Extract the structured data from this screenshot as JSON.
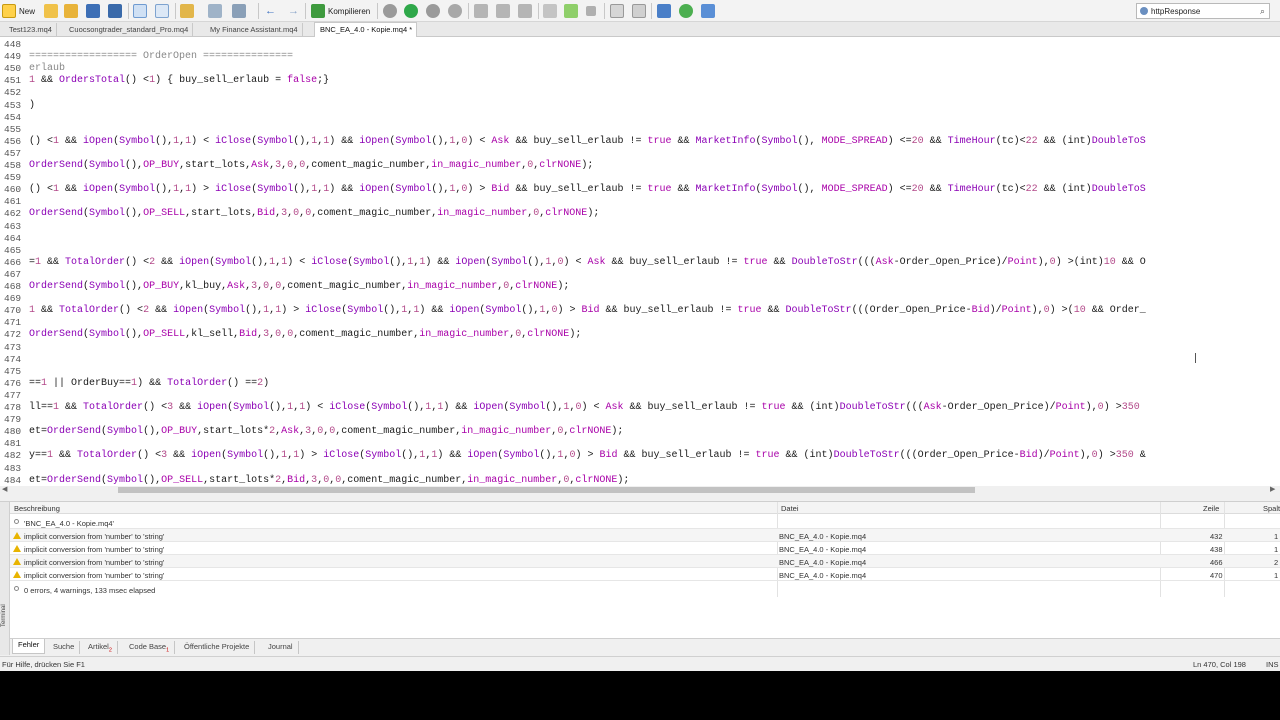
{
  "toolbar": {
    "new_label": "New",
    "compile_label": "Kompilieren",
    "search_value": "httpResponse"
  },
  "tabs": [
    {
      "label": "Test123.mq4"
    },
    {
      "label": "Cuocsongtrader_standard_Pro.mq4"
    },
    {
      "label": "My Finance Assistant.mq4"
    },
    {
      "label": "BNC_EA_4.0 - Kopie.mq4 *"
    }
  ],
  "editor": {
    "lines": [
      {
        "n": "448",
        "t": ""
      },
      {
        "n": "449",
        "t": "================== OrderOpen ==============="
      },
      {
        "n": "450",
        "t": "erlaub"
      },
      {
        "n": "451",
        "t": "1 && OrdersTotal() <1) { buy_sell_erlaub = false;}"
      },
      {
        "n": "452",
        "t": ""
      },
      {
        "n": "453",
        "t": ")"
      },
      {
        "n": "454",
        "t": ""
      },
      {
        "n": "455",
        "t": ""
      },
      {
        "n": "456",
        "t": "() <1 && iOpen(Symbol(),1,1) < iClose(Symbol(),1,1) && iOpen(Symbol(),1,0) < Ask && buy_sell_erlaub != true && MarketInfo(Symbol(), MODE_SPREAD) <=20 && TimeHour(tc)<22 && (int)DoubleToS"
      },
      {
        "n": "457",
        "t": ""
      },
      {
        "n": "458",
        "t": "OrderSend(Symbol(),OP_BUY,start_lots,Ask,3,0,0,coment_magic_number,in_magic_number,0,clrNONE);"
      },
      {
        "n": "459",
        "t": ""
      },
      {
        "n": "460",
        "t": "() <1 && iOpen(Symbol(),1,1) > iClose(Symbol(),1,1) && iOpen(Symbol(),1,0) > Bid && buy_sell_erlaub != true && MarketInfo(Symbol(), MODE_SPREAD) <=20 && TimeHour(tc)<22 && (int)DoubleToS"
      },
      {
        "n": "461",
        "t": ""
      },
      {
        "n": "462",
        "t": "OrderSend(Symbol(),OP_SELL,start_lots,Bid,3,0,0,coment_magic_number,in_magic_number,0,clrNONE);"
      },
      {
        "n": "463",
        "t": ""
      },
      {
        "n": "464",
        "t": ""
      },
      {
        "n": "465",
        "t": ""
      },
      {
        "n": "466",
        "t": "=1 && TotalOrder() <2 && iOpen(Symbol(),1,1) < iClose(Symbol(),1,1) && iOpen(Symbol(),1,0) < Ask && buy_sell_erlaub != true && DoubleToStr(((Ask-Order_Open_Price)/Point),0) >(int)10 && O"
      },
      {
        "n": "467",
        "t": ""
      },
      {
        "n": "468",
        "t": "OrderSend(Symbol(),OP_BUY,kl_buy,Ask,3,0,0,coment_magic_number,in_magic_number,0,clrNONE);"
      },
      {
        "n": "469",
        "t": ""
      },
      {
        "n": "470",
        "t": "1 && TotalOrder() <2 && iOpen(Symbol(),1,1) > iClose(Symbol(),1,1) && iOpen(Symbol(),1,0) > Bid && buy_sell_erlaub != true && DoubleToStr(((Order_Open_Price-Bid)/Point),0) >(10 && Order_"
      },
      {
        "n": "471",
        "t": ""
      },
      {
        "n": "472",
        "t": "OrderSend(Symbol(),OP_SELL,kl_sell,Bid,3,0,0,coment_magic_number,in_magic_number,0,clrNONE);"
      },
      {
        "n": "473",
        "t": ""
      },
      {
        "n": "474",
        "t": ""
      },
      {
        "n": "475",
        "t": ""
      },
      {
        "n": "476",
        "t": "==1 || OrderBuy==1) && TotalOrder() ==2)"
      },
      {
        "n": "477",
        "t": ""
      },
      {
        "n": "478",
        "t": "ll==1 && TotalOrder() <3 && iOpen(Symbol(),1,1) < iClose(Symbol(),1,1) && iOpen(Symbol(),1,0) < Ask && buy_sell_erlaub != true && (int)DoubleToStr(((Ask-Order_Open_Price)/Point),0) >350"
      },
      {
        "n": "479",
        "t": ""
      },
      {
        "n": "480",
        "t": "et=OrderSend(Symbol(),OP_BUY,start_lots*2,Ask,3,0,0,coment_magic_number,in_magic_number,0,clrNONE);"
      },
      {
        "n": "481",
        "t": ""
      },
      {
        "n": "482",
        "t": "y==1 && TotalOrder() <3 && iOpen(Symbol(),1,1) > iClose(Symbol(),1,1) && iOpen(Symbol(),1,0) > Bid && buy_sell_erlaub != true && (int)DoubleToStr(((Order_Open_Price-Bid)/Point),0) >350 &"
      },
      {
        "n": "483",
        "t": ""
      },
      {
        "n": "484",
        "t": "et=OrderSend(Symbol(),OP_SELL,start_lots*2,Bid,3,0,0,coment_magic_number,in_magic_number,0,clrNONE);"
      }
    ]
  },
  "errors": {
    "headers": {
      "desc": "Beschreibung",
      "file": "Datei",
      "line": "Zeile",
      "col": "Spalte"
    },
    "file_header": "'BNC_EA_4.0 - Kopie.mq4'",
    "rows": [
      {
        "desc": "implicit conversion from 'number' to 'string'",
        "file": "BNC_EA_4.0 - Kopie.mq4",
        "line": "432",
        "col": "1"
      },
      {
        "desc": "implicit conversion from 'number' to 'string'",
        "file": "BNC_EA_4.0 - Kopie.mq4",
        "line": "438",
        "col": "1"
      },
      {
        "desc": "implicit conversion from 'number' to 'string'",
        "file": "BNC_EA_4.0 - Kopie.mq4",
        "line": "466",
        "col": "2"
      },
      {
        "desc": "implicit conversion from 'number' to 'string'",
        "file": "BNC_EA_4.0 - Kopie.mq4",
        "line": "470",
        "col": "1"
      }
    ],
    "summary": "0 errors, 4 warnings, 133 msec elapsed"
  },
  "terminal_label": "Terminal",
  "bottom_tabs": [
    {
      "label": "Fehler"
    },
    {
      "label": "Suche"
    },
    {
      "label": "Artikel",
      "sub": "2"
    },
    {
      "label": "Code Base",
      "sub": "1"
    },
    {
      "label": "Öffentliche Projekte"
    },
    {
      "label": "Journal"
    }
  ],
  "status": {
    "help": "Für Hilfe, drücken Sie F1",
    "position": "Ln 470, Col 198",
    "mode": "INS"
  }
}
